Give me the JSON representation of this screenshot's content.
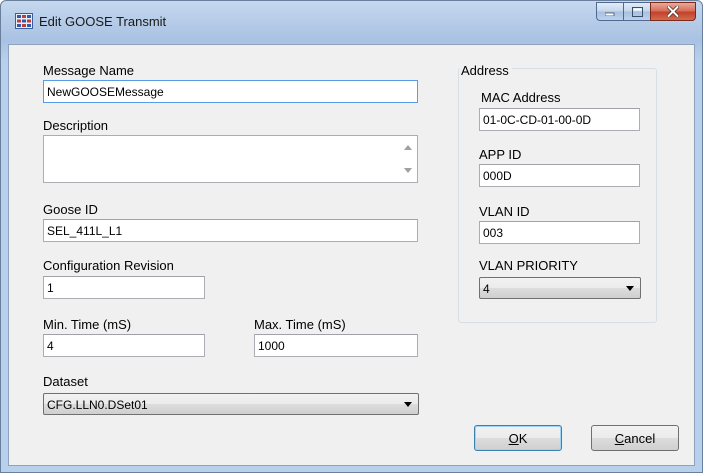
{
  "window": {
    "title": "Edit GOOSE Transmit",
    "icon": "app-grid-icon",
    "caption_buttons": [
      "minimize-icon",
      "maximize-icon",
      "close-icon"
    ]
  },
  "form": {
    "message_name": {
      "label": "Message Name",
      "value": "NewGOOSEMessage"
    },
    "description": {
      "label": "Description",
      "value": ""
    },
    "goose_id": {
      "label": "Goose ID",
      "value": "SEL_411L_L1"
    },
    "config_revision": {
      "label": "Configuration Revision",
      "value": "1"
    },
    "min_time": {
      "label": "Min. Time (mS)",
      "value": "4"
    },
    "max_time": {
      "label": "Max. Time (mS)",
      "value": "1000"
    },
    "dataset": {
      "label": "Dataset",
      "selected": "CFG.LLN0.DSet01"
    }
  },
  "address": {
    "group_label": "Address",
    "mac": {
      "label": "MAC Address",
      "value": "01-0C-CD-01-00-0D"
    },
    "app_id": {
      "label": "APP ID",
      "value": "000D"
    },
    "vlan_id": {
      "label": "VLAN ID",
      "value": "003"
    },
    "vlan_priority": {
      "label": "VLAN PRIORITY",
      "selected": "4"
    }
  },
  "buttons": {
    "ok_mnemonic": "O",
    "ok_rest": "K",
    "cancel_mnemonic": "C",
    "cancel_rest": "ancel"
  },
  "colors": {
    "titlebar": "#b6cce8",
    "client": "#f0f0f0",
    "close_button": "#c2422a",
    "focus_border": "#569de5"
  }
}
